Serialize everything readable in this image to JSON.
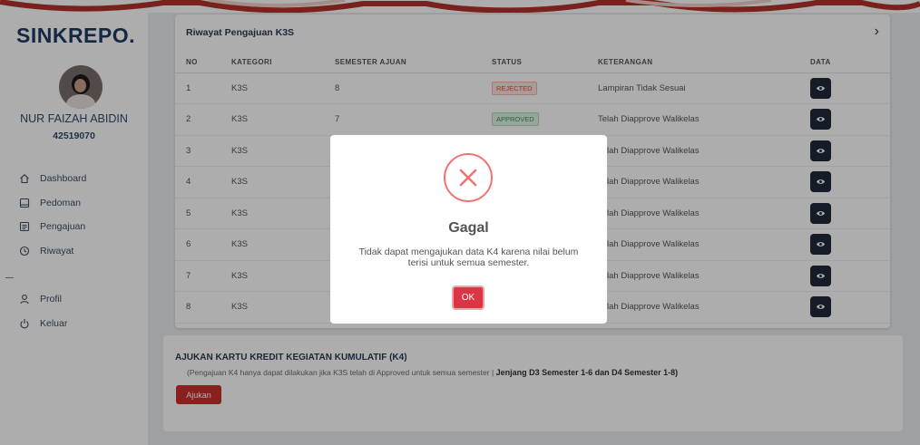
{
  "sidebar": {
    "brand": "SINKREPO.",
    "user_name": "NUR FAIZAH ABIDIN",
    "user_id": "42519070",
    "items": [
      {
        "label": "Dashboard",
        "icon": "home-icon"
      },
      {
        "label": "Pedoman",
        "icon": "book-icon"
      },
      {
        "label": "Pengajuan",
        "icon": "list-icon"
      },
      {
        "label": "Riwayat",
        "icon": "history-icon"
      }
    ],
    "items2": [
      {
        "label": "Profil",
        "icon": "user-icon"
      },
      {
        "label": "Keluar",
        "icon": "power-icon"
      }
    ]
  },
  "history": {
    "title": "Riwayat Pengajuan K3S",
    "columns": [
      "NO",
      "KATEGORI",
      "SEMESTER AJUAN",
      "STATUS",
      "KETERANGAN",
      "DATA"
    ],
    "rows": [
      {
        "no": "1",
        "kategori": "K3S",
        "semester": "8",
        "status": "REJECTED",
        "keterangan": "Lampiran Tidak Sesuai"
      },
      {
        "no": "2",
        "kategori": "K3S",
        "semester": "7",
        "status": "APPROVED",
        "keterangan": "Telah Diapprove Walikelas"
      },
      {
        "no": "3",
        "kategori": "K3S",
        "semester": "",
        "status": "",
        "keterangan": "Telah Diapprove Walikelas"
      },
      {
        "no": "4",
        "kategori": "K3S",
        "semester": "",
        "status": "",
        "keterangan": "Telah Diapprove Walikelas"
      },
      {
        "no": "5",
        "kategori": "K3S",
        "semester": "",
        "status": "",
        "keterangan": "Telah Diapprove Walikelas"
      },
      {
        "no": "6",
        "kategori": "K3S",
        "semester": "",
        "status": "",
        "keterangan": "Telah Diapprove Walikelas"
      },
      {
        "no": "7",
        "kategori": "K3S",
        "semester": "",
        "status": "",
        "keterangan": "Telah Diapprove Walikelas"
      },
      {
        "no": "8",
        "kategori": "K3S",
        "semester": "",
        "status": "",
        "keterangan": "Telah Diapprove Walikelas"
      }
    ]
  },
  "k4": {
    "title": "AJUKAN KARTU KREDIT KEGIATAN KUMULATIF (K4)",
    "note": "(Pengajuan K4 hanya dapat dilakukan jika K3S telah di Approved untuk semua semester |",
    "note_bold": "Jenjang D3 Semester 1-6 dan D4 Semester 1-8)",
    "button": "Ajukan"
  },
  "modal": {
    "title": "Gagal",
    "message": "Tidak dapat mengajukan data K4 karena nilai belum terisi untuk semua semester.",
    "ok_label": "OK",
    "icon": "error-x-icon"
  },
  "colors": {
    "brand": "#1f3b63",
    "danger": "#dc3545",
    "error_ring": "#f27474",
    "eye_button": "#1f2a3a"
  }
}
